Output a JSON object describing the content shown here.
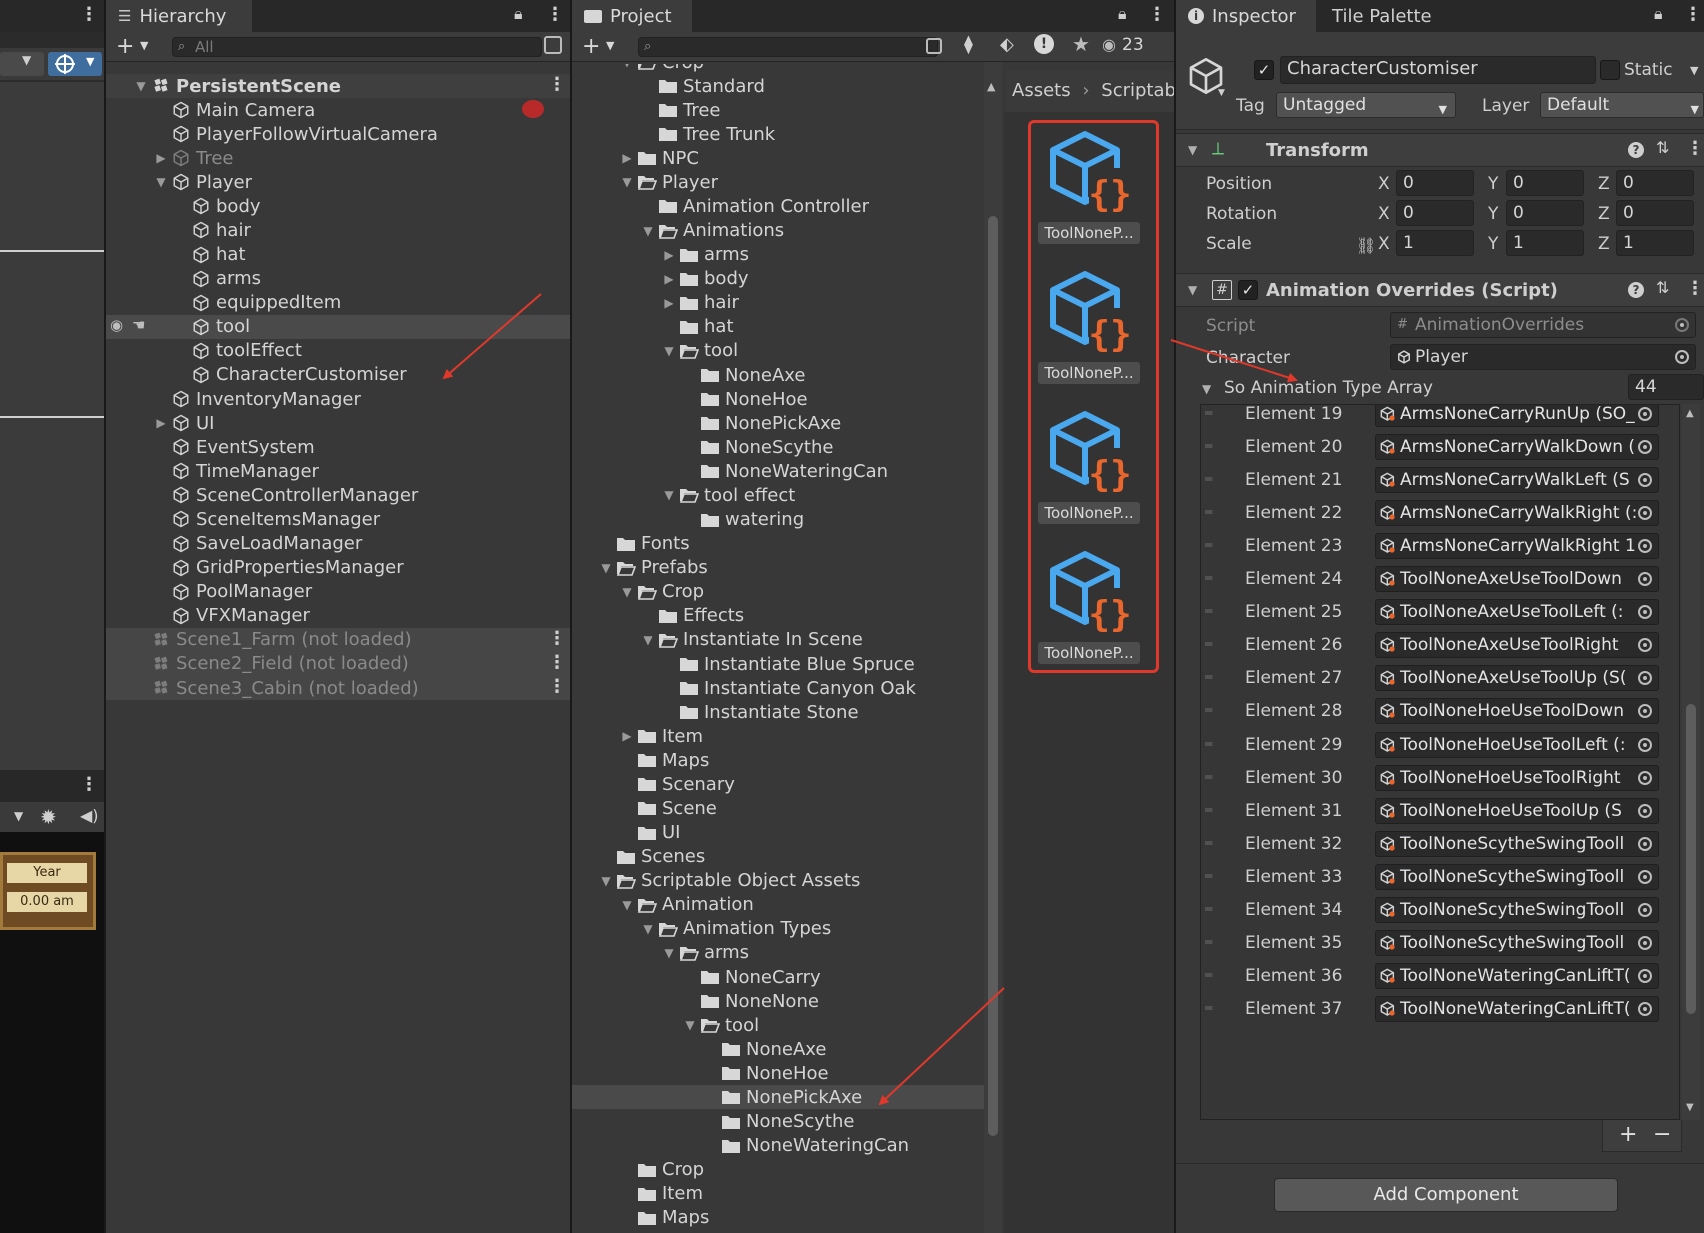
{
  "left_strip": {
    "badge_year": "Year",
    "badge_time": "0.00 am"
  },
  "hierarchy": {
    "tab_label": "Hierarchy",
    "search_placeholder": "All",
    "items": [
      {
        "label": "PersistentScene",
        "depth": 0,
        "arrow": "down",
        "icon": "unity-scene-icon",
        "bold": true,
        "state": "scene"
      },
      {
        "label": "Main Camera",
        "depth": 1,
        "arrow": "none",
        "icon": "gameobject-cube-icon"
      },
      {
        "label": "PlayerFollowVirtualCamera",
        "depth": 1,
        "arrow": "none",
        "icon": "gameobject-cube-icon"
      },
      {
        "label": "Tree",
        "depth": 1,
        "arrow": "right",
        "icon": "gameobject-cube-icon",
        "state": "dim"
      },
      {
        "label": "Player",
        "depth": 1,
        "arrow": "down",
        "icon": "gameobject-cube-icon"
      },
      {
        "label": "body",
        "depth": 2,
        "arrow": "none",
        "icon": "gameobject-cube-icon"
      },
      {
        "label": "hair",
        "depth": 2,
        "arrow": "none",
        "icon": "gameobject-cube-icon"
      },
      {
        "label": "hat",
        "depth": 2,
        "arrow": "none",
        "icon": "gameobject-cube-icon"
      },
      {
        "label": "arms",
        "depth": 2,
        "arrow": "none",
        "icon": "gameobject-cube-icon"
      },
      {
        "label": "equippedItem",
        "depth": 2,
        "arrow": "none",
        "icon": "gameobject-cube-icon"
      },
      {
        "label": "tool",
        "depth": 2,
        "arrow": "none",
        "icon": "gameobject-cube-icon",
        "state": "hover"
      },
      {
        "label": "toolEffect",
        "depth": 2,
        "arrow": "none",
        "icon": "gameobject-cube-icon"
      },
      {
        "label": "CharacterCustomiser",
        "depth": 2,
        "arrow": "none",
        "icon": "gameobject-cube-icon"
      },
      {
        "label": "InventoryManager",
        "depth": 1,
        "arrow": "none",
        "icon": "gameobject-cube-icon"
      },
      {
        "label": "UI",
        "depth": 1,
        "arrow": "right",
        "icon": "gameobject-cube-icon"
      },
      {
        "label": "EventSystem",
        "depth": 1,
        "arrow": "none",
        "icon": "gameobject-cube-icon"
      },
      {
        "label": "TimeManager",
        "depth": 1,
        "arrow": "none",
        "icon": "gameobject-cube-icon"
      },
      {
        "label": "SceneControllerManager",
        "depth": 1,
        "arrow": "none",
        "icon": "gameobject-cube-icon"
      },
      {
        "label": "SceneItemsManager",
        "depth": 1,
        "arrow": "none",
        "icon": "gameobject-cube-icon"
      },
      {
        "label": "SaveLoadManager",
        "depth": 1,
        "arrow": "none",
        "icon": "gameobject-cube-icon"
      },
      {
        "label": "GridPropertiesManager",
        "depth": 1,
        "arrow": "none",
        "icon": "gameobject-cube-icon"
      },
      {
        "label": "PoolManager",
        "depth": 1,
        "arrow": "none",
        "icon": "gameobject-cube-icon"
      },
      {
        "label": "VFXManager",
        "depth": 1,
        "arrow": "none",
        "icon": "gameobject-cube-icon"
      },
      {
        "label": "Scene1_Farm (not loaded)",
        "depth": 0,
        "arrow": "none",
        "icon": "unity-scene-icon",
        "state": "scene-unloaded"
      },
      {
        "label": "Scene2_Field (not loaded)",
        "depth": 0,
        "arrow": "none",
        "icon": "unity-scene-icon",
        "state": "scene-unloaded"
      },
      {
        "label": "Scene3_Cabin (not loaded)",
        "depth": 0,
        "arrow": "none",
        "icon": "unity-scene-icon",
        "state": "scene-unloaded"
      }
    ]
  },
  "project": {
    "tab_label": "Project",
    "hidden_count": "23",
    "breadcrumb": [
      "Assets",
      "Scriptabl"
    ],
    "tree": [
      {
        "label": "Crop",
        "depth": 2,
        "arrow": "down",
        "open": true
      },
      {
        "label": "Standard",
        "depth": 3,
        "arrow": "none"
      },
      {
        "label": "Tree",
        "depth": 3,
        "arrow": "none"
      },
      {
        "label": "Tree Trunk",
        "depth": 3,
        "arrow": "none"
      },
      {
        "label": "NPC",
        "depth": 2,
        "arrow": "right"
      },
      {
        "label": "Player",
        "depth": 2,
        "arrow": "down",
        "open": true
      },
      {
        "label": "Animation Controller",
        "depth": 3,
        "arrow": "none"
      },
      {
        "label": "Animations",
        "depth": 3,
        "arrow": "down",
        "open": true
      },
      {
        "label": "arms",
        "depth": 4,
        "arrow": "right"
      },
      {
        "label": "body",
        "depth": 4,
        "arrow": "right"
      },
      {
        "label": "hair",
        "depth": 4,
        "arrow": "right"
      },
      {
        "label": "hat",
        "depth": 4,
        "arrow": "none"
      },
      {
        "label": "tool",
        "depth": 4,
        "arrow": "down",
        "open": true
      },
      {
        "label": "NoneAxe",
        "depth": 5,
        "arrow": "none"
      },
      {
        "label": "NoneHoe",
        "depth": 5,
        "arrow": "none"
      },
      {
        "label": "NonePickAxe",
        "depth": 5,
        "arrow": "none"
      },
      {
        "label": "NoneScythe",
        "depth": 5,
        "arrow": "none"
      },
      {
        "label": "NoneWateringCan",
        "depth": 5,
        "arrow": "none"
      },
      {
        "label": "tool effect",
        "depth": 4,
        "arrow": "down",
        "open": true
      },
      {
        "label": "watering",
        "depth": 5,
        "arrow": "none"
      },
      {
        "label": "Fonts",
        "depth": 1,
        "arrow": "none"
      },
      {
        "label": "Prefabs",
        "depth": 1,
        "arrow": "down",
        "open": true
      },
      {
        "label": "Crop",
        "depth": 2,
        "arrow": "down",
        "open": true
      },
      {
        "label": "Effects",
        "depth": 3,
        "arrow": "none"
      },
      {
        "label": "Instantiate In Scene",
        "depth": 3,
        "arrow": "down",
        "open": true
      },
      {
        "label": "Instantiate Blue Spruce",
        "depth": 4,
        "arrow": "none"
      },
      {
        "label": "Instantiate Canyon Oak",
        "depth": 4,
        "arrow": "none"
      },
      {
        "label": "Instantiate Stone",
        "depth": 4,
        "arrow": "none"
      },
      {
        "label": "Item",
        "depth": 2,
        "arrow": "right"
      },
      {
        "label": "Maps",
        "depth": 2,
        "arrow": "none"
      },
      {
        "label": "Scenary",
        "depth": 2,
        "arrow": "none"
      },
      {
        "label": "Scene",
        "depth": 2,
        "arrow": "none"
      },
      {
        "label": "UI",
        "depth": 2,
        "arrow": "none"
      },
      {
        "label": "Scenes",
        "depth": 1,
        "arrow": "none"
      },
      {
        "label": "Scriptable Object Assets",
        "depth": 1,
        "arrow": "down",
        "open": true
      },
      {
        "label": "Animation",
        "depth": 2,
        "arrow": "down",
        "open": true
      },
      {
        "label": "Animation Types",
        "depth": 3,
        "arrow": "down",
        "open": true
      },
      {
        "label": "arms",
        "depth": 4,
        "arrow": "down",
        "open": true
      },
      {
        "label": "NoneCarry",
        "depth": 5,
        "arrow": "none"
      },
      {
        "label": "NoneNone",
        "depth": 5,
        "arrow": "none"
      },
      {
        "label": "tool",
        "depth": 5,
        "arrow": "down",
        "open": true
      },
      {
        "label": "NoneAxe",
        "depth": 6,
        "arrow": "none"
      },
      {
        "label": "NoneHoe",
        "depth": 6,
        "arrow": "none"
      },
      {
        "label": "NonePickAxe",
        "depth": 6,
        "arrow": "none",
        "selected": true
      },
      {
        "label": "NoneScythe",
        "depth": 6,
        "arrow": "none"
      },
      {
        "label": "NoneWateringCan",
        "depth": 6,
        "arrow": "none"
      },
      {
        "label": "Crop",
        "depth": 2,
        "arrow": "none"
      },
      {
        "label": "Item",
        "depth": 2,
        "arrow": "none"
      },
      {
        "label": "Maps",
        "depth": 2,
        "arrow": "none"
      }
    ],
    "assets": [
      "ToolNoneP...",
      "ToolNoneP...",
      "ToolNoneP...",
      "ToolNoneP..."
    ]
  },
  "inspector": {
    "tab_label": "Inspector",
    "tab2_label": "Tile Palette",
    "object_name": "CharacterCustomiser",
    "static_label": "Static",
    "tag_label": "Tag",
    "tag_value": "Untagged",
    "layer_label": "Layer",
    "layer_value": "Default",
    "transform": {
      "title": "Transform",
      "position_label": "Position",
      "rotation_label": "Rotation",
      "scale_label": "Scale",
      "position": [
        "0",
        "0",
        "0"
      ],
      "rotation": [
        "0",
        "0",
        "0"
      ],
      "scale": [
        "1",
        "1",
        "1"
      ],
      "axes": [
        "X",
        "Y",
        "Z"
      ]
    },
    "script_component": {
      "title": "Animation Overrides (Script)",
      "script_label": "Script",
      "script_value": "AnimationOverrides",
      "character_label": "Character",
      "character_value": "Player",
      "array_label": "So Animation Type Array",
      "array_size": "44",
      "elements": [
        {
          "name": "Element 19",
          "value": "ArmsNoneCarryRunUp (SO_"
        },
        {
          "name": "Element 20",
          "value": "ArmsNoneCarryWalkDown ("
        },
        {
          "name": "Element 21",
          "value": "ArmsNoneCarryWalkLeft (S"
        },
        {
          "name": "Element 22",
          "value": "ArmsNoneCarryWalkRight (:"
        },
        {
          "name": "Element 23",
          "value": "ArmsNoneCarryWalkRight 1"
        },
        {
          "name": "Element 24",
          "value": "ToolNoneAxeUseToolDown"
        },
        {
          "name": "Element 25",
          "value": "ToolNoneAxeUseToolLeft (:"
        },
        {
          "name": "Element 26",
          "value": "ToolNoneAxeUseToolRight"
        },
        {
          "name": "Element 27",
          "value": "ToolNoneAxeUseToolUp (S("
        },
        {
          "name": "Element 28",
          "value": "ToolNoneHoeUseToolDown"
        },
        {
          "name": "Element 29",
          "value": "ToolNoneHoeUseToolLeft (:"
        },
        {
          "name": "Element 30",
          "value": "ToolNoneHoeUseToolRight"
        },
        {
          "name": "Element 31",
          "value": "ToolNoneHoeUseToolUp (S"
        },
        {
          "name": "Element 32",
          "value": "ToolNoneScytheSwingTooll"
        },
        {
          "name": "Element 33",
          "value": "ToolNoneScytheSwingTooll"
        },
        {
          "name": "Element 34",
          "value": "ToolNoneScytheSwingTooll"
        },
        {
          "name": "Element 35",
          "value": "ToolNoneScytheSwingTooll"
        },
        {
          "name": "Element 36",
          "value": "ToolNoneWateringCanLiftT("
        },
        {
          "name": "Element 37",
          "value": "ToolNoneWateringCanLiftT("
        }
      ],
      "plus": "+",
      "minus": "−"
    },
    "add_component": "Add Component"
  },
  "colors": {
    "annotation_red": "#e0392b",
    "icon_blue": "#4aa8ef",
    "icon_orange": "#e9662c",
    "panel_bg": "#383838"
  }
}
